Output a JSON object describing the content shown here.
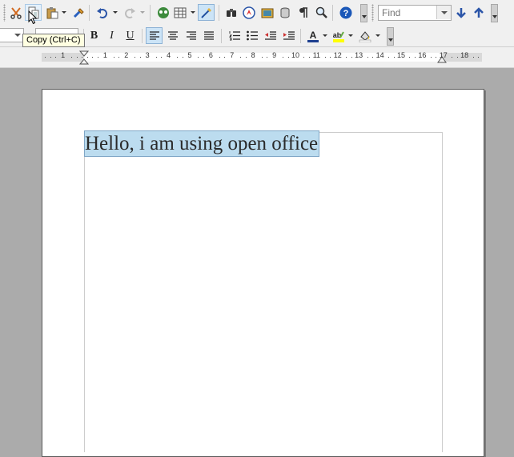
{
  "toolbar_standard": {
    "find": {
      "placeholder": "Find"
    }
  },
  "toolbar_formatting": {
    "bold_label": "B",
    "italic_label": "I",
    "underline_label": "U"
  },
  "tooltip": {
    "text": "Copy (Ctrl+C)"
  },
  "ruler": {
    "numbers": [
      "1",
      "1",
      "2",
      "3",
      "4",
      "5",
      "6",
      "7",
      "8",
      "9",
      "10",
      "11",
      "12",
      "13",
      "14",
      "15",
      "16",
      "17",
      "18"
    ]
  },
  "document": {
    "text": "Hello, i am using open office"
  },
  "colors": {
    "selection_highlight": "#bcdcef",
    "font_color_bar": "#1e3f8f",
    "highlight_bar": "#ffff00",
    "help_icon": "#1b58b8"
  }
}
